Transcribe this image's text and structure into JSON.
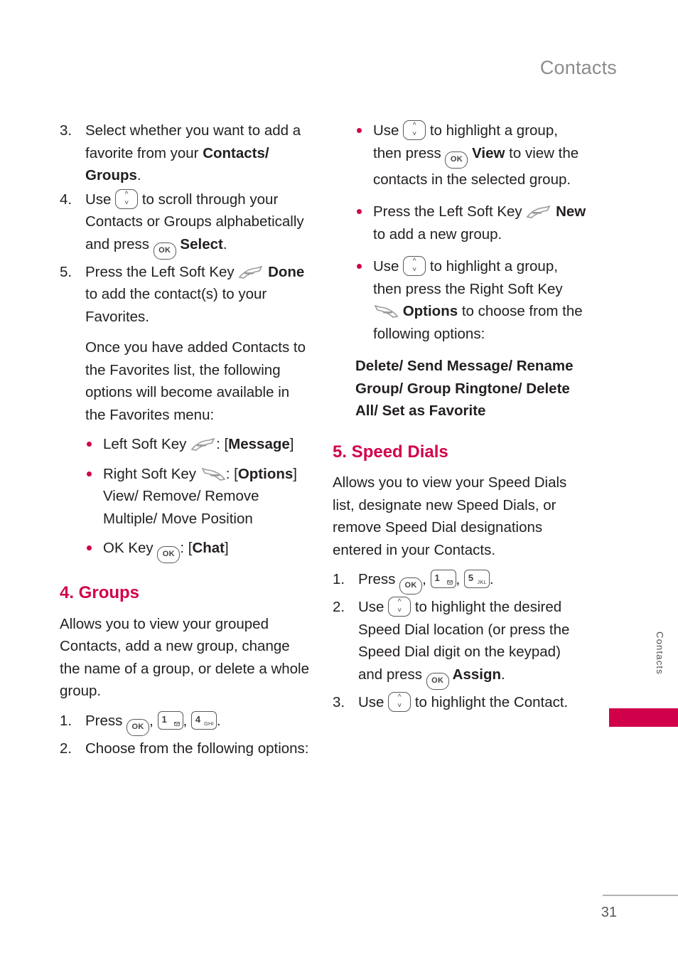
{
  "header": {
    "title": "Contacts"
  },
  "side_tab": {
    "label": "Contacts"
  },
  "footer": {
    "page_number": "31"
  },
  "left_column": {
    "items": [
      {
        "marker": "3.",
        "parts": [
          {
            "t": "text",
            "v": "Select whether you want to add a favorite from your "
          },
          {
            "t": "bold",
            "v": "Contacts/ Groups"
          },
          {
            "t": "text",
            "v": "."
          }
        ]
      },
      {
        "marker": "4.",
        "parts": [
          {
            "t": "text",
            "v": "Use "
          },
          {
            "t": "key",
            "v": "nav-up-down-key"
          },
          {
            "t": "text",
            "v": " to scroll through your Contacts or Groups alphabetically and press "
          },
          {
            "t": "key",
            "v": "ok-key"
          },
          {
            "t": "bold",
            "v": " Select"
          },
          {
            "t": "text",
            "v": "."
          }
        ]
      },
      {
        "marker": "5.",
        "parts": [
          {
            "t": "text",
            "v": "Press the Left Soft Key "
          },
          {
            "t": "key",
            "v": "left-soft-key"
          },
          {
            "t": "bold",
            "v": " Done"
          },
          {
            "t": "text",
            "v": " to add the contact(s) to your Favorites."
          }
        ]
      }
    ],
    "paragraph": "Once you have added Contacts to the Favorites list, the following options will become available in the Favorites menu:",
    "bullets": [
      {
        "parts": [
          {
            "t": "text",
            "v": "Left Soft Key "
          },
          {
            "t": "key",
            "v": "left-soft-key"
          },
          {
            "t": "text",
            "v": ": ["
          },
          {
            "t": "bold",
            "v": "Message"
          },
          {
            "t": "text",
            "v": "]"
          }
        ]
      },
      {
        "parts": [
          {
            "t": "text",
            "v": "Right Soft Key "
          },
          {
            "t": "key",
            "v": "right-soft-key"
          },
          {
            "t": "text",
            "v": ": ["
          },
          {
            "t": "bold",
            "v": "Options"
          },
          {
            "t": "text",
            "v": "] View/ Remove/ Remove Multiple/ Move Position"
          }
        ]
      },
      {
        "parts": [
          {
            "t": "text",
            "v": "OK Key "
          },
          {
            "t": "key",
            "v": "ok-key"
          },
          {
            "t": "text",
            "v": ": ["
          },
          {
            "t": "bold",
            "v": "Chat"
          },
          {
            "t": "text",
            "v": "]"
          }
        ]
      }
    ],
    "section": {
      "title": "4. Groups"
    },
    "section_paragraph": "Allows you to view your grouped Contacts, add a new group, change the name of a group, or delete a whole group.",
    "section_items": [
      {
        "marker": "1.",
        "parts": [
          {
            "t": "text",
            "v": "Press "
          },
          {
            "t": "key",
            "v": "ok-key"
          },
          {
            "t": "text",
            "v": ", "
          },
          {
            "t": "key",
            "v": "num-1-voicemail-key"
          },
          {
            "t": "text",
            "v": ", "
          },
          {
            "t": "key",
            "v": "num-4-ghi-key"
          },
          {
            "t": "text",
            "v": "."
          }
        ]
      },
      {
        "marker": "2.",
        "parts": [
          {
            "t": "text",
            "v": "Choose from the following options:"
          }
        ]
      }
    ]
  },
  "right_column": {
    "bullets": [
      {
        "parts": [
          {
            "t": "text",
            "v": "Use "
          },
          {
            "t": "key",
            "v": "nav-up-down-key"
          },
          {
            "t": "text",
            "v": " to highlight a group, then press "
          },
          {
            "t": "key",
            "v": "ok-key"
          },
          {
            "t": "bold",
            "v": " View"
          },
          {
            "t": "text",
            "v": " to view the contacts in the selected group."
          }
        ]
      },
      {
        "parts": [
          {
            "t": "text",
            "v": "Press the Left Soft Key "
          },
          {
            "t": "key",
            "v": "left-soft-key"
          },
          {
            "t": "bold",
            "v": " New"
          },
          {
            "t": "text",
            "v": " to add a new group."
          }
        ]
      },
      {
        "parts": [
          {
            "t": "text",
            "v": "Use "
          },
          {
            "t": "key",
            "v": "nav-up-down-key"
          },
          {
            "t": "text",
            "v": " to highlight a group, then press the Right Soft Key "
          },
          {
            "t": "key",
            "v": "right-soft-key"
          },
          {
            "t": "bold",
            "v": " Options"
          },
          {
            "t": "text",
            "v": " to choose from the following options:"
          }
        ]
      }
    ],
    "options_list": "Delete/ Send Message/ Rename Group/ Group Ringtone/ Delete All/ Set as Favorite",
    "section": {
      "title": "5. Speed Dials"
    },
    "section_paragraph": "Allows you to view your Speed Dials list, designate new Speed Dials, or remove Speed Dial designations entered in your Contacts.",
    "section_items": [
      {
        "marker": "1.",
        "parts": [
          {
            "t": "text",
            "v": "Press "
          },
          {
            "t": "key",
            "v": "ok-key"
          },
          {
            "t": "text",
            "v": ", "
          },
          {
            "t": "key",
            "v": "num-1-voicemail-key"
          },
          {
            "t": "text",
            "v": ", "
          },
          {
            "t": "key",
            "v": "num-5-jkl-key"
          },
          {
            "t": "text",
            "v": "."
          }
        ]
      },
      {
        "marker": "2.",
        "parts": [
          {
            "t": "text",
            "v": "Use "
          },
          {
            "t": "key",
            "v": "nav-up-down-key"
          },
          {
            "t": "text",
            "v": " to highlight the desired Speed Dial location (or press the Speed Dial digit on the keypad) and press "
          },
          {
            "t": "key",
            "v": "ok-key"
          },
          {
            "t": "bold",
            "v": " Assign"
          },
          {
            "t": "text",
            "v": "."
          }
        ]
      },
      {
        "marker": "3.",
        "parts": [
          {
            "t": "text",
            "v": "Use "
          },
          {
            "t": "key",
            "v": "nav-up-down-key"
          },
          {
            "t": "text",
            "v": " to highlight the Contact."
          }
        ]
      }
    ]
  },
  "keys": {
    "ok_label": "OK",
    "num1_label": "1",
    "num4_label": "4",
    "num4_sub": "GHI",
    "num5_label": "5",
    "num5_sub": "JKL"
  },
  "colors": {
    "accent": "#d1004b",
    "body_text": "#231f20",
    "header_gray": "#8c8c8c"
  }
}
